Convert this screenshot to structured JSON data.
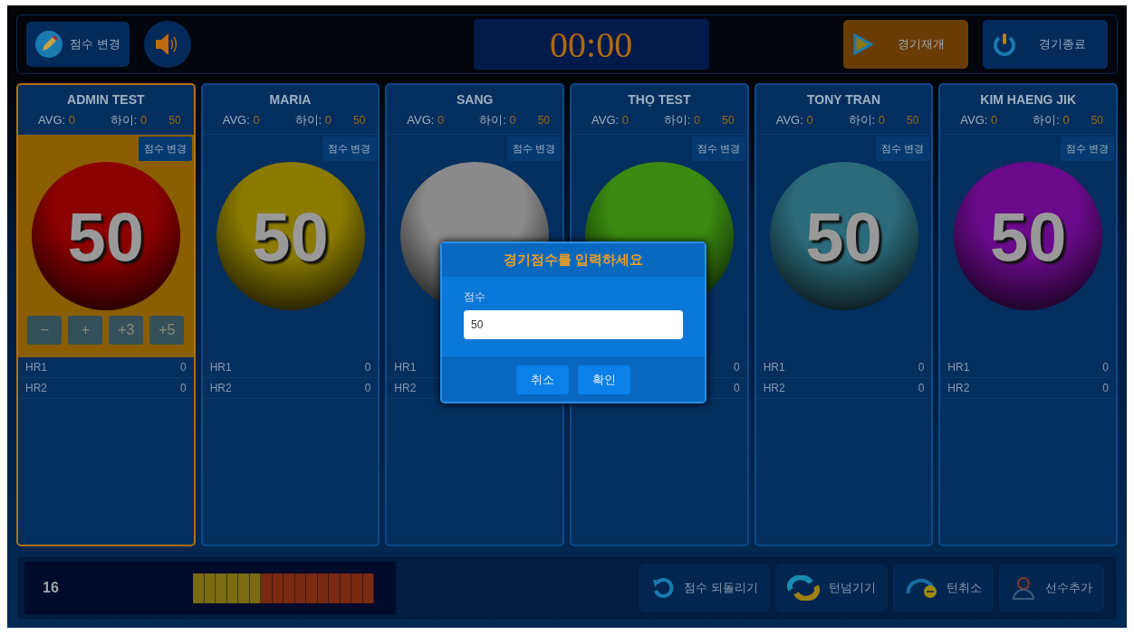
{
  "top_bar": {
    "edit_score_button": "점수 변경",
    "timer": "00:00",
    "resume_button": "경기재개",
    "end_button": "경기종료"
  },
  "players": [
    {
      "name": "ADMIN TEST",
      "avg_label": "AVG:",
      "avg": "0",
      "high_label": "하이:",
      "high": "0",
      "target": "50",
      "edit_button": "점수 변경",
      "score": "50",
      "color": "#8b0000",
      "selected": true,
      "runs": [
        {
          "label": "HR1",
          "value": "0"
        },
        {
          "label": "HR2",
          "value": "0"
        }
      ]
    },
    {
      "name": "MARIA",
      "avg_label": "AVG:",
      "avg": "0",
      "high_label": "하이:",
      "high": "0",
      "target": "50",
      "edit_button": "점수 변경",
      "score": "50",
      "color": "#8a7a00",
      "selected": false,
      "runs": [
        {
          "label": "HR1",
          "value": "0"
        },
        {
          "label": "HR2",
          "value": "0"
        }
      ]
    },
    {
      "name": "SANG",
      "avg_label": "AVG:",
      "avg": "0",
      "high_label": "하이:",
      "high": "0",
      "target": "50",
      "edit_button": "점수 변경",
      "color": "#8a8a8a",
      "selected": false,
      "runs": [
        {
          "label": "HR1"
        },
        {
          "label": "HR2"
        }
      ]
    },
    {
      "name": "THỌ TEST",
      "avg_label": "AVG:",
      "avg": "0",
      "high_label": "하이:",
      "high": "0",
      "target": "50",
      "edit_button": "점수 변경",
      "color": "#3a8a10",
      "selected": false,
      "runs": [
        {
          "value": "0"
        },
        {
          "value": "0"
        }
      ]
    },
    {
      "name": "TONY TRAN",
      "avg_label": "AVG:",
      "avg": "0",
      "high_label": "하이:",
      "high": "0",
      "target": "50",
      "edit_button": "점수 변경",
      "score": "50",
      "color": "#2a6a7a",
      "selected": false,
      "runs": [
        {
          "label": "HR1",
          "value": "0"
        },
        {
          "label": "HR2",
          "value": "0"
        }
      ]
    },
    {
      "name": "KIM HAENG JIK",
      "avg_label": "AVG:",
      "avg": "0",
      "high_label": "하이:",
      "high": "0",
      "target": "50",
      "edit_button": "점수 변경",
      "score": "50",
      "color": "#6a0a8a",
      "selected": false,
      "runs": [
        {
          "label": "HR1",
          "value": "0"
        },
        {
          "label": "HR2",
          "value": "0"
        }
      ]
    }
  ],
  "score_controls": [
    "−",
    "+",
    "+3",
    "+5"
  ],
  "bottom_bar": {
    "inning": "16",
    "actions": [
      {
        "kind": "undo",
        "label": "점수 되돌리기"
      },
      {
        "kind": "turn",
        "label": "턴넘기기"
      },
      {
        "kind": "cancel",
        "label": "턴취소"
      },
      {
        "kind": "add",
        "label": "선수추가"
      }
    ]
  },
  "dialog": {
    "title": "경기점수를 입력하세요",
    "field_label": "점수",
    "value": "50",
    "buttons": [
      "취소",
      "확인"
    ]
  }
}
